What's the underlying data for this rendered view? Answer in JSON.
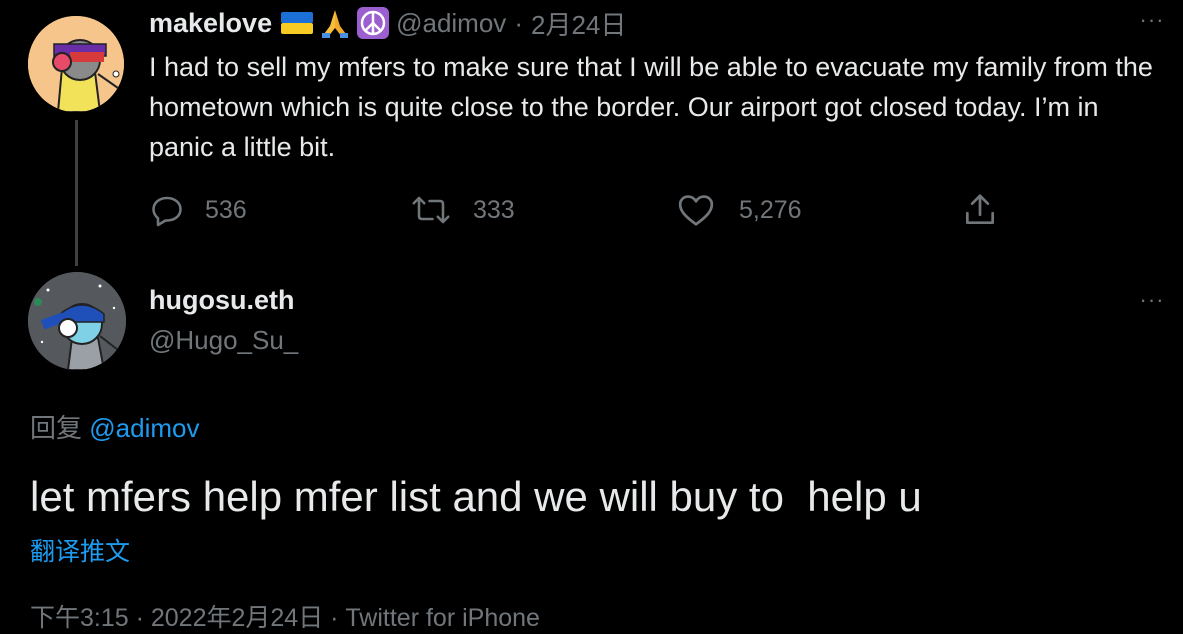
{
  "parent_tweet": {
    "display_name": "makelove",
    "emojis": [
      "ukraine-flag",
      "folded-hands",
      "peace-symbol"
    ],
    "handle": "@adimov",
    "separator": "·",
    "date": "2月24日",
    "more": "···",
    "text": "I had to sell my mfers to make sure that I will be able to evacuate my family from the hometown which is quite close to the border. Our airport got closed today. I’m in panic a little bit.",
    "actions": {
      "reply_count": "536",
      "retweet_count": "333",
      "like_count": "5,276"
    }
  },
  "reply_tweet": {
    "display_name": "hugosu.eth",
    "handle": "@Hugo_Su_",
    "more": "···",
    "replying_to_label": "回复",
    "replying_to_handle": "@adimov",
    "text": "let mfers help mfer list and we will buy to  help u",
    "translate_label": "翻译推文",
    "timestamp": "下午3:15 · 2022年2月24日 · Twitter for iPhone"
  },
  "colors": {
    "background": "#000000",
    "text": "#e7e9ea",
    "muted": "#71767b",
    "link": "#1d9bf0"
  }
}
